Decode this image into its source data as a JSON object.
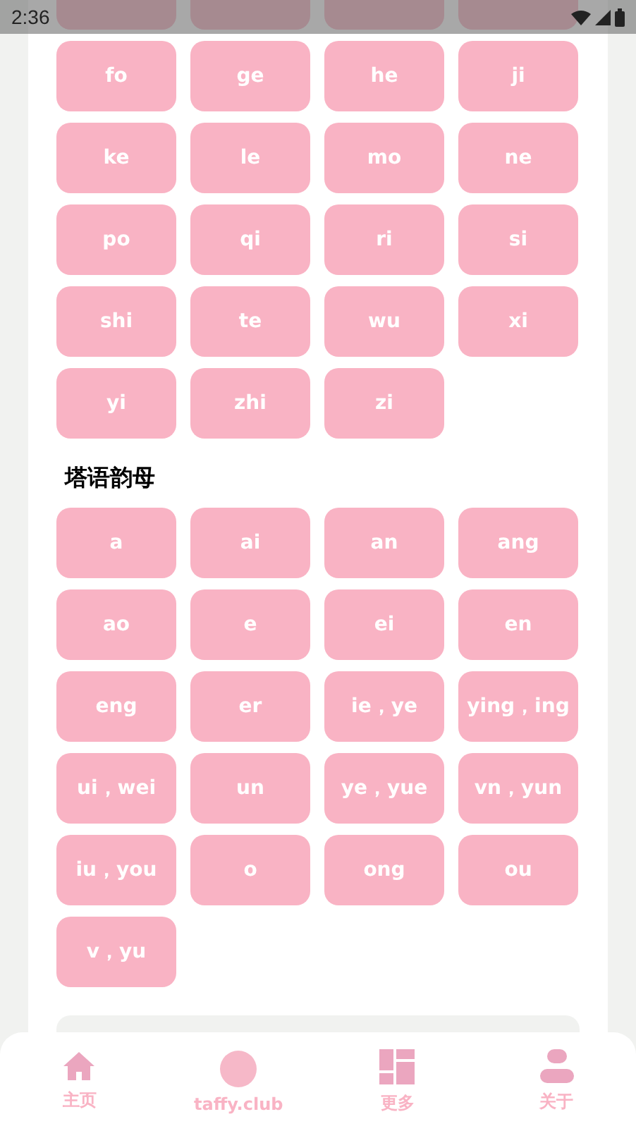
{
  "status_bar": {
    "time": "2:36"
  },
  "initials": [
    "fo",
    "ge",
    "he",
    "ji",
    "ke",
    "le",
    "mo",
    "ne",
    "po",
    "qi",
    "ri",
    "si",
    "shi",
    "te",
    "wu",
    "xi",
    "yi",
    "zhi",
    "zi"
  ],
  "finals_section": {
    "title": "塔语韵母",
    "items": [
      "a",
      "ai",
      "an",
      "ang",
      "ao",
      "e",
      "ei",
      "en",
      "eng",
      "er",
      "ie，ye",
      "ying，ing",
      "ui，wei",
      "un",
      "ye，yue",
      "vn，yun",
      "iu，you",
      "o",
      "ong",
      "ou",
      "v，yu"
    ]
  },
  "bottom_nav": [
    {
      "kind": "home",
      "label": "主页"
    },
    {
      "kind": "avatar",
      "label": "taffy.club"
    },
    {
      "kind": "grid",
      "label": "更多"
    },
    {
      "kind": "person",
      "label": "关于"
    }
  ]
}
